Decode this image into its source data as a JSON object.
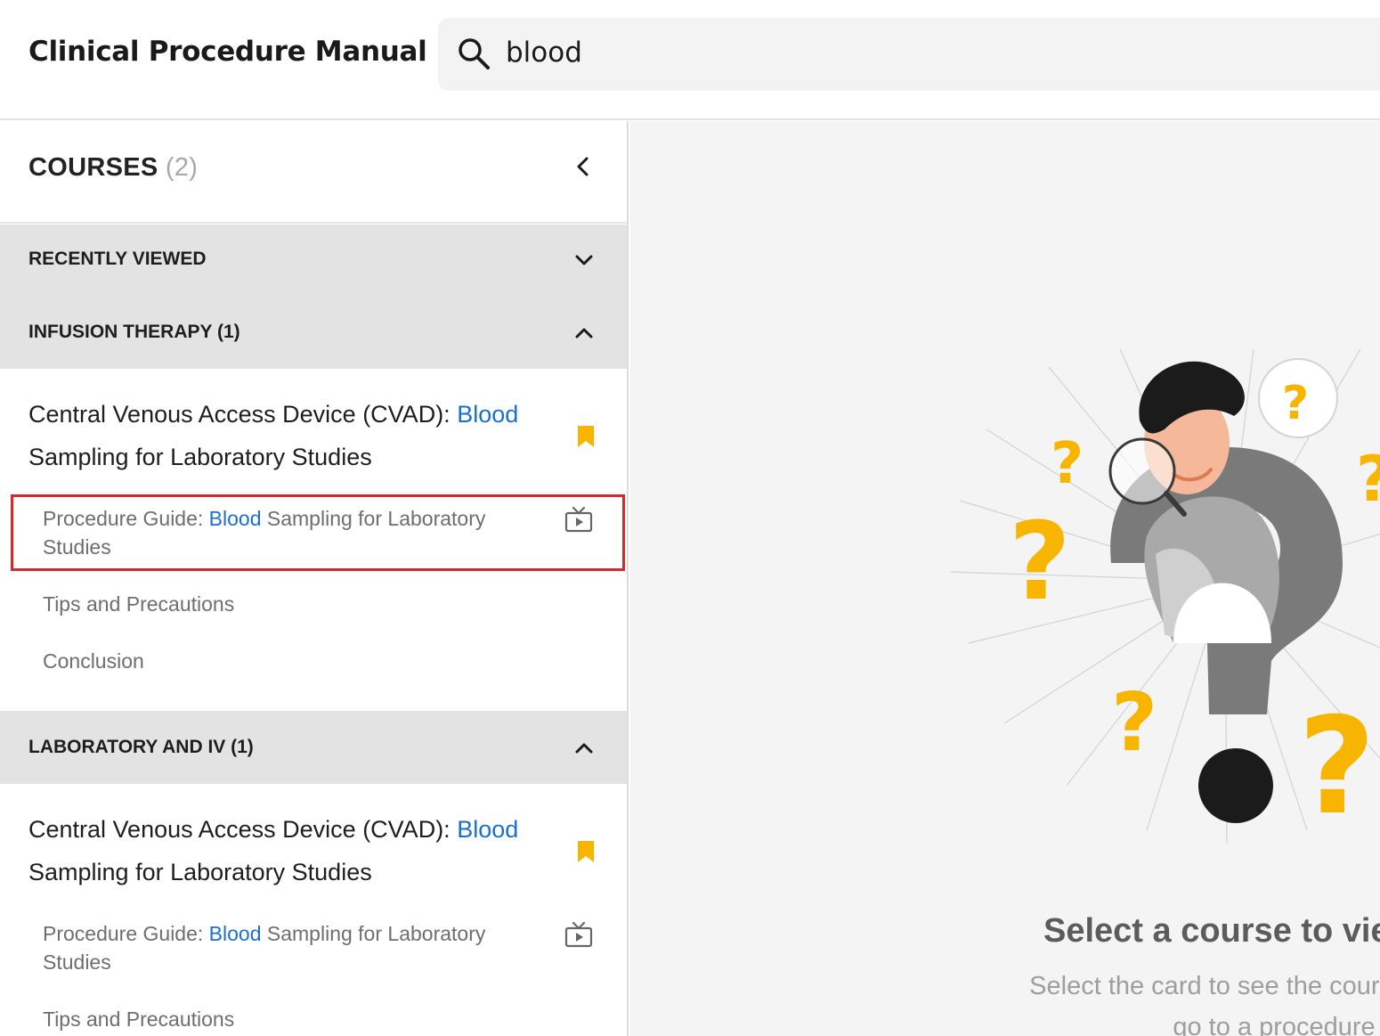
{
  "header": {
    "app_title": "Clinical Procedure Manual",
    "search": {
      "value": "blood",
      "icon": "search-icon"
    }
  },
  "sidebar": {
    "courses_label": "COURSES",
    "courses_count": "(2)",
    "sections": [
      {
        "label": "RECENTLY VIEWED",
        "expanded": false
      },
      {
        "label": "INFUSION THERAPY (1)",
        "expanded": true,
        "course": {
          "title_before": "Central Venous Access Device (CVAD): ",
          "title_highlight": "Blood",
          "title_after": " Sampling for Laboratory Studies",
          "bookmarked": true,
          "lessons": [
            {
              "prefix": "Procedure Guide: ",
              "highlight": "Blood",
              "suffix": " Sampling for Laboratory Studies",
              "icon": "video-icon",
              "selected": true
            },
            {
              "text": "Tips and Precautions"
            },
            {
              "text": "Conclusion"
            }
          ]
        }
      },
      {
        "label": "LABORATORY AND IV (1)",
        "expanded": true,
        "course": {
          "title_before": "Central Venous Access Device (CVAD): ",
          "title_highlight": "Blood",
          "title_after": " Sampling for Laboratory Studies",
          "bookmarked": true,
          "lessons": [
            {
              "prefix": "Procedure Guide: ",
              "highlight": "Blood",
              "suffix": " Sampling for Laboratory Studies",
              "icon": "video-icon"
            },
            {
              "text": "Tips and Precautions"
            }
          ]
        }
      }
    ]
  },
  "main": {
    "empty_title": "Select a course to vie",
    "empty_subtitle": "Select the card to see the cour overview or go to a procedure"
  },
  "colors": {
    "highlight": "#1a70d1",
    "bookmark": "#f7b500",
    "selection_border": "#d32a2a",
    "section_bg": "#e3e3e3",
    "main_bg": "#f4f4f4"
  }
}
